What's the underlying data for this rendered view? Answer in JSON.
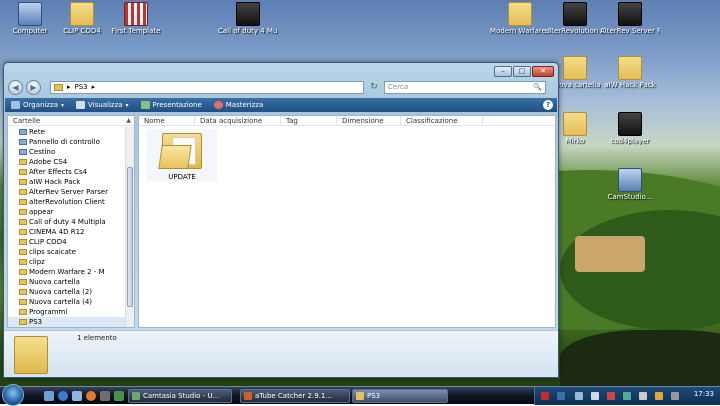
{
  "desktop": {
    "icons": [
      {
        "name": "desk-icon-computer",
        "label": "Computer",
        "type": "pc"
      },
      {
        "name": "desk-icon-clip-cod4",
        "label": "CLIP COD4",
        "type": "folder"
      },
      {
        "name": "desk-icon-first-template",
        "label": "First Template",
        "type": "video"
      },
      {
        "name": "desk-icon-call-of-duty",
        "label": "Call of duty 4 Multiplayer",
        "type": "app"
      },
      {
        "name": "desk-icon-modern-warfare",
        "label": "Modern Warfare 2",
        "type": "folder"
      },
      {
        "name": "desk-icon-alterrevolution",
        "label": "alterRevolution Client",
        "type": "app"
      },
      {
        "name": "desk-icon-alterrev-server",
        "label": "AlterRev Server Parser",
        "type": "app"
      },
      {
        "name": "desk-icon-nuova-cartella",
        "label": "Nuova cartella",
        "type": "folder"
      },
      {
        "name": "desk-icon-aiw-hack",
        "label": "aIW Hack Pack",
        "type": "folder"
      },
      {
        "name": "desk-icon-mirko",
        "label": "Mirko",
        "type": "folder"
      },
      {
        "name": "desk-icon-cod4player",
        "label": "cod4player",
        "type": "app"
      },
      {
        "name": "desk-icon-camstudio",
        "label": "CamStudio...",
        "type": "pc"
      }
    ]
  },
  "window": {
    "minimize": "–",
    "maximize": "□",
    "close": "✕",
    "back": "◀",
    "forward": "▶",
    "address": "PS3",
    "address_arrow": "▸",
    "search_placeholder": "Cerca",
    "search_icon": "🔍",
    "toolbar": {
      "organizza": "Organizza",
      "visualizza": "Visualizza",
      "presentazione": "Presentazione",
      "masterizza": "Masterizza",
      "caret": "▾",
      "help": "?"
    },
    "nav": {
      "header": "Cartelle",
      "header_arrow": "▲",
      "items": [
        {
          "label": "Rete",
          "kind": "sys"
        },
        {
          "label": "Pannello di controllo",
          "kind": "sys"
        },
        {
          "label": "Cestino",
          "kind": "sys"
        },
        {
          "label": "Adobe CS4",
          "kind": "folder"
        },
        {
          "label": "After Effects Cs4",
          "kind": "folder"
        },
        {
          "label": "aIW Hack Pack",
          "kind": "folder"
        },
        {
          "label": "AlterRev Server Parser",
          "kind": "folder"
        },
        {
          "label": "alterRevolution Client",
          "kind": "folder"
        },
        {
          "label": "appear",
          "kind": "folder"
        },
        {
          "label": "Call of duty 4 Multipla",
          "kind": "folder"
        },
        {
          "label": "CINEMA 4D R12",
          "kind": "folder"
        },
        {
          "label": "CLIP COD4",
          "kind": "folder"
        },
        {
          "label": "clips scaicate",
          "kind": "folder"
        },
        {
          "label": "clipz",
          "kind": "folder"
        },
        {
          "label": "Modern Warfare 2 - M",
          "kind": "folder"
        },
        {
          "label": "Nuova cartella",
          "kind": "folder"
        },
        {
          "label": "Nuova cartella (2)",
          "kind": "folder"
        },
        {
          "label": "Nuova cartella (4)",
          "kind": "folder"
        },
        {
          "label": "Programmi",
          "kind": "folder"
        },
        {
          "label": "PS3",
          "kind": "folder",
          "selected": true
        }
      ]
    },
    "columns": [
      "Nome",
      "Data acquisizione",
      "Tag",
      "Dimensione",
      "Classificazione"
    ],
    "files": [
      {
        "label": "UPDATE"
      }
    ],
    "details": {
      "count": "1 elemento"
    }
  },
  "taskbar": {
    "tasks": [
      {
        "label": "Camtasia Studio - U...",
        "color": "#6fa86f"
      },
      {
        "label": "aTube Catcher 2.9.1...",
        "color": "#d0602a"
      },
      {
        "label": "PS3",
        "color": "#e6c25c",
        "active": true
      }
    ],
    "clock": "17:33"
  }
}
